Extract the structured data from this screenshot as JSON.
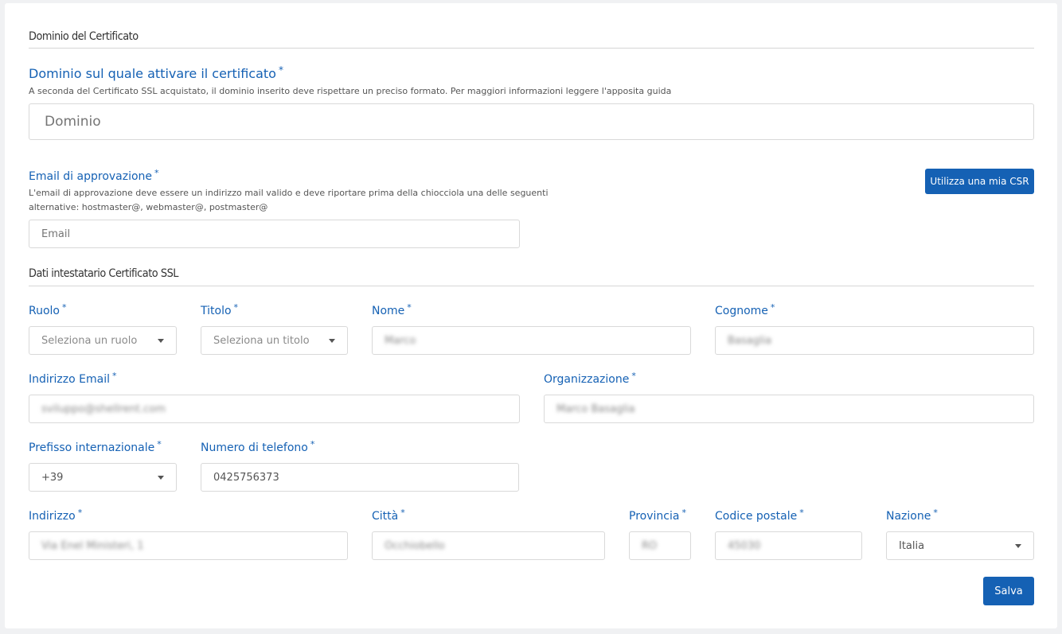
{
  "sections": {
    "domain_title": "Dominio del Certificato",
    "holder_title": "Dati intestatario Certificato SSL"
  },
  "domain": {
    "label": "Dominio sul quale attivare il certificato",
    "help": "A seconda del Certificato SSL acquistato, il dominio inserito deve rispettare un preciso formato. Per maggiori informazioni leggere l'apposita guida",
    "placeholder": "Dominio"
  },
  "approval_email": {
    "label": "Email di approvazione",
    "help_line1": "L'email di approvazione deve essere un indirizzo mail valido e deve riportare prima della chiocciola una delle seguenti",
    "help_line2": "alternative: hostmaster@, webmaster@, postmaster@",
    "placeholder": "Email"
  },
  "csr_button": "Utilizza una mia CSR",
  "required_mark": "*",
  "fields": {
    "ruolo": {
      "label": "Ruolo",
      "placeholder": "Seleziona un ruolo"
    },
    "titolo": {
      "label": "Titolo",
      "placeholder": "Seleziona un titolo"
    },
    "nome": {
      "label": "Nome",
      "value": "Marco"
    },
    "cognome": {
      "label": "Cognome",
      "value": "Basaglia"
    },
    "email": {
      "label": "Indirizzo Email",
      "value": "sviluppo@shellrent.com"
    },
    "organizzazione": {
      "label": "Organizzazione",
      "value": "Marco Basaglia"
    },
    "prefisso": {
      "label": "Prefisso internazionale",
      "value": "+39"
    },
    "telefono": {
      "label": "Numero di telefono",
      "value": "0425756373"
    },
    "indirizzo": {
      "label": "Indirizzo",
      "value": "Via Enel Ministeri, 1"
    },
    "citta": {
      "label": "Città",
      "value": "Occhiobello"
    },
    "provincia": {
      "label": "Provincia",
      "value": "RO"
    },
    "cap": {
      "label": "Codice postale",
      "value": "45030"
    },
    "nazione": {
      "label": "Nazione",
      "value": "Italia"
    }
  },
  "save_button": "Salva",
  "colors": {
    "accent": "#1561b4",
    "background": "#f0f1f3"
  }
}
